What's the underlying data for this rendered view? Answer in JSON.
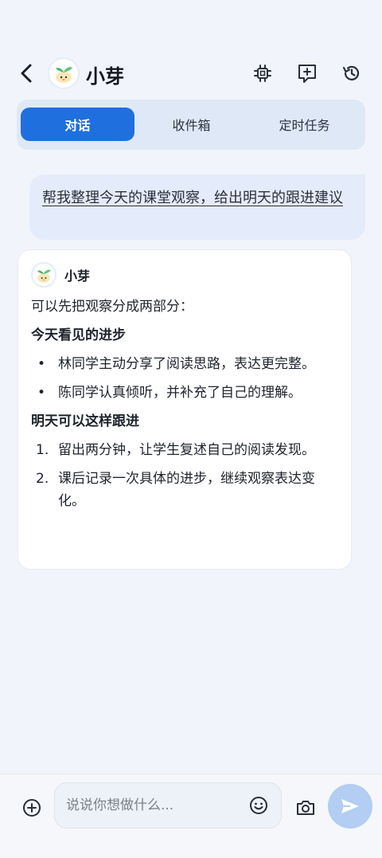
{
  "header": {
    "title": "小芽",
    "icons": [
      "back-arrow-icon",
      "sprout-avatar",
      "chip-icon",
      "new-chat-icon",
      "history-icon"
    ]
  },
  "tabs": [
    {
      "label": "对话",
      "active": true
    },
    {
      "label": "收件箱",
      "active": false
    },
    {
      "label": "定时任务",
      "active": false
    }
  ],
  "user_message": {
    "text": "帮我整理今天的课堂观察，给出明天的跟进建议"
  },
  "assistant": {
    "name": "小芽",
    "intro": "可以先把观察分成两部分：",
    "section1": {
      "heading": "今天看见的进步",
      "items": [
        "林同学主动分享了阅读思路，表达更完整。",
        "陈同学认真倾听，并补充了自己的理解。"
      ]
    },
    "section2": {
      "heading": "明天可以这样跟进",
      "items": [
        {
          "num": "1.",
          "text": "留出两分钟，让学生复述自己的阅读发现。"
        },
        {
          "num": "2.",
          "text": "课后记录一次具体的进步，继续观察表达变化。"
        }
      ]
    }
  },
  "composer": {
    "placeholder": "说说你想做什么...",
    "icons": [
      "plus-circle-icon",
      "emoji-icon",
      "camera-icon",
      "send-icon"
    ]
  },
  "colors": {
    "accent": "#1f6fde",
    "background": "#f1f4fa",
    "user_bubble": "#e4ecfb",
    "send_button": "#b3cdf3"
  }
}
